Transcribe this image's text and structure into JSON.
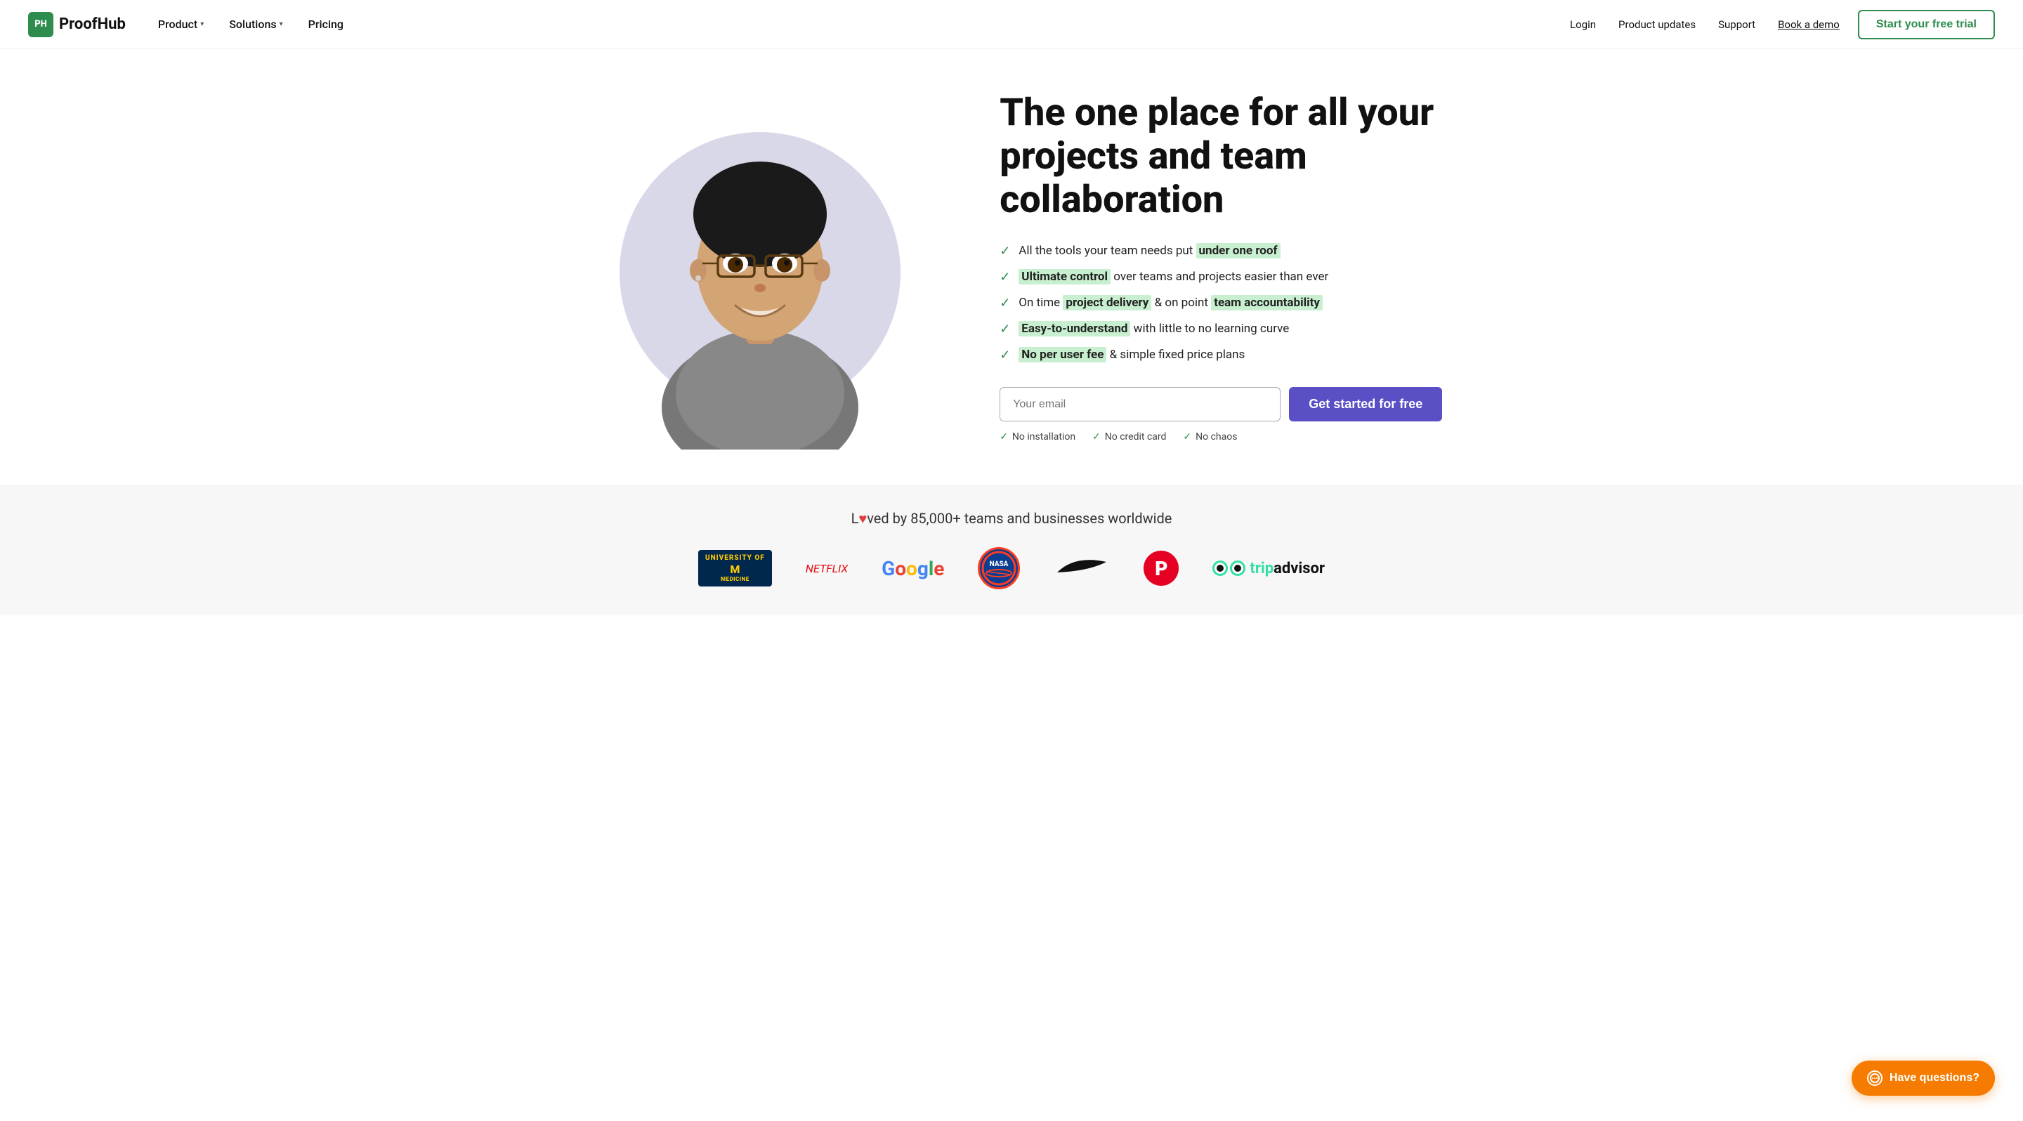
{
  "nav": {
    "logo_icon": "PH",
    "logo_text": "ProofHub",
    "links_left": [
      {
        "label": "Product",
        "has_dropdown": true
      },
      {
        "label": "Solutions",
        "has_dropdown": true
      },
      {
        "label": "Pricing",
        "has_dropdown": false
      }
    ],
    "links_right": [
      {
        "label": "Login"
      },
      {
        "label": "Product updates"
      },
      {
        "label": "Support"
      },
      {
        "label": "Book a demo"
      }
    ],
    "cta": "Start your free trial"
  },
  "hero": {
    "title": "The one place for all your projects and team collaboration",
    "bullets": [
      {
        "text_plain": "All the tools your team needs put ",
        "highlight": "under one roof",
        "text_after": ""
      },
      {
        "text_plain": "",
        "highlight": "Ultimate control",
        "text_after": " over teams and projects easier than ever"
      },
      {
        "text_plain": "On time ",
        "highlight": "project delivery",
        "text_after": " & on point ",
        "highlight2": "team accountability",
        "text_after2": ""
      },
      {
        "text_plain": "",
        "highlight": "Easy-to-understand",
        "text_after": " with little to no learning curve"
      },
      {
        "text_plain": "",
        "highlight": "No per user fee",
        "text_after": " & simple fixed price plans"
      }
    ],
    "email_placeholder": "Your email",
    "cta_button": "Get started for free",
    "badges": [
      "No installation",
      "No credit card",
      "No chaos"
    ]
  },
  "loved": {
    "text_before": "L",
    "text_heart": "♥",
    "text_after": "ved by 85,000+ teams and businesses worldwide"
  },
  "chat_button": {
    "label": "Have questions?"
  }
}
